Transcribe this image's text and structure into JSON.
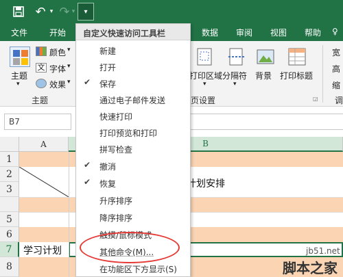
{
  "quick_access": {
    "save_icon": "save-icon",
    "undo_icon": "undo-icon",
    "redo_icon": "redo-icon",
    "customize_icon": "customize-qat-icon",
    "undo_glyph": "↶",
    "redo_glyph": "↷",
    "customize_glyph": "▾"
  },
  "menu": {
    "tabs": [
      "文件",
      "开始",
      "数据",
      "审阅",
      "视图",
      "帮助",
      "♀"
    ]
  },
  "ribbon": {
    "theme_label": "主题",
    "colors_label": "颜色",
    "fonts_label": "字体",
    "effects_label": "效果",
    "theme_group": "主题",
    "print_area": "打印区域",
    "breaks": "分隔符",
    "background": "背景",
    "print_titles": "打印标题",
    "page_setup_group": "页设置",
    "partial_right_1": "宽",
    "partial_right_2": "高",
    "partial_right_3": "缩",
    "partial_group_right": "调",
    "dropdown_caret": "▾"
  },
  "namebox": {
    "value": "B7"
  },
  "columns": [
    "A",
    "B"
  ],
  "rows": [
    "1",
    "2",
    "3",
    "5",
    "6",
    "7",
    "8"
  ],
  "cells": {
    "b2": "计划安排",
    "a7": "学习计划"
  },
  "dropdown": {
    "title": "自定义快速访问工具栏",
    "items": [
      {
        "label": "新建",
        "checked": false
      },
      {
        "label": "打开",
        "checked": false
      },
      {
        "label": "保存",
        "checked": true
      },
      {
        "label": "通过电子邮件发送",
        "checked": false
      },
      {
        "label": "快速打印",
        "checked": false
      },
      {
        "label": "打印预览和打印",
        "checked": false
      },
      {
        "label": "拼写检查",
        "checked": false
      },
      {
        "label": "撤消",
        "checked": true
      },
      {
        "label": "恢复",
        "checked": true
      },
      {
        "label": "升序排序",
        "checked": false
      },
      {
        "label": "降序排序",
        "checked": false
      },
      {
        "label": "触摸/鼠标模式",
        "checked": false
      },
      {
        "label": "其他命令(M)...",
        "checked": false
      },
      {
        "label": "在功能区下方显示(S)",
        "checked": false
      }
    ],
    "check_glyph": "✔"
  },
  "watermark": {
    "url": "jb51.net",
    "text": "脚本之家"
  },
  "colors": {
    "excel_green": "#217346",
    "row_band": "#fbd4b4",
    "highlight": "#e53935"
  }
}
